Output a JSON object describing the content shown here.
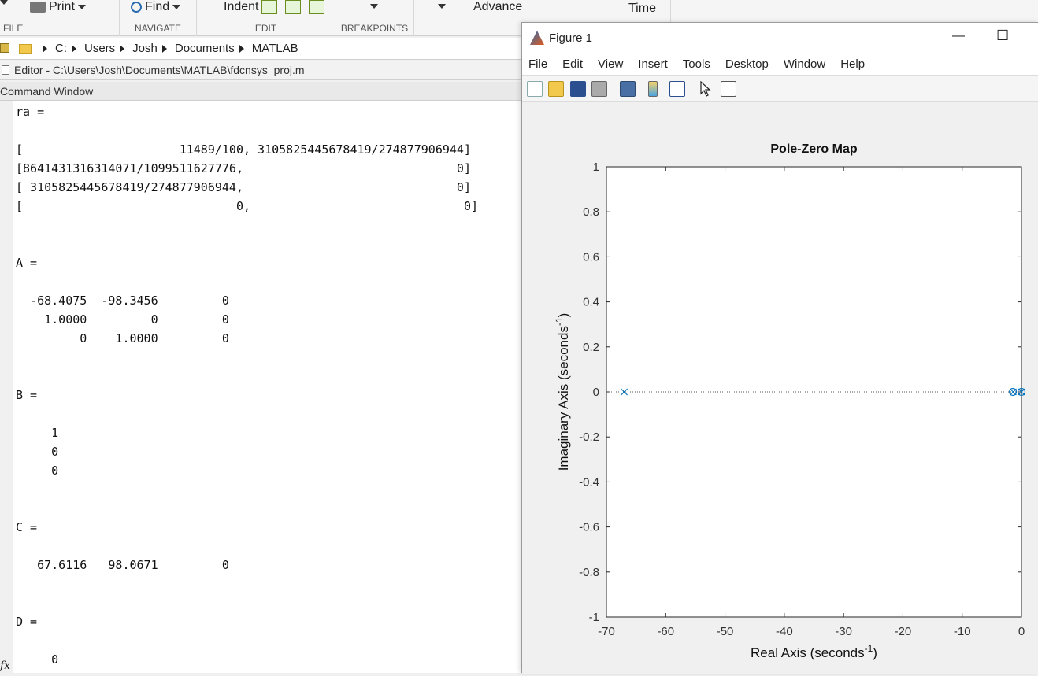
{
  "toolstrip": {
    "print_label": "Print",
    "find_label": "Find",
    "indent_label": "Indent",
    "advance_label": "Advance",
    "time_label": "Time",
    "groups": {
      "file": "FILE",
      "navigate": "NAVIGATE",
      "edit": "EDIT",
      "breakpoints": "BREAKPOINTS"
    }
  },
  "address": {
    "crumbs": [
      "C:",
      "Users",
      "Josh",
      "Documents",
      "MATLAB"
    ]
  },
  "editor_bar": {
    "title": "Editor - C:\\Users\\Josh\\Documents\\MATLAB\\fdcnsys_proj.m"
  },
  "command_window": {
    "title": "Command Window",
    "lines": [
      "ra =",
      "",
      "[                      11489/100, 3105825445678419/274877906944]",
      "[8641431316314071/1099511627776,                              0]",
      "[ 3105825445678419/274877906944,                              0]",
      "[                              0,                              0]",
      "",
      "",
      "A =",
      "",
      "  -68.4075  -98.3456         0",
      "    1.0000         0         0",
      "         0    1.0000         0",
      "",
      "",
      "B =",
      "",
      "     1",
      "     0",
      "     0",
      "",
      "",
      "C =",
      "",
      "   67.6116   98.0671         0",
      "",
      "",
      "D =",
      "",
      "     0"
    ],
    "prompt": "fx"
  },
  "figure": {
    "title": "Figure 1",
    "menu": [
      "File",
      "Edit",
      "View",
      "Insert",
      "Tools",
      "Desktop",
      "Window",
      "Help"
    ],
    "minimize_glyph": "—",
    "maximize_glyph": "☐"
  },
  "chart_data": {
    "type": "scatter",
    "title": "Pole-Zero Map",
    "xlabel": "Real Axis (seconds",
    "ylabel": "Imaginary Axis (seconds",
    "label_superscript": "-1",
    "label_close": ")",
    "xlim": [
      -70,
      0
    ],
    "ylim": [
      -1,
      1
    ],
    "xticks": [
      "-70",
      "-60",
      "-50",
      "-40",
      "-30",
      "-20",
      "-10",
      "0"
    ],
    "yticks": [
      "-1",
      "-0.8",
      "-0.6",
      "-0.4",
      "-0.2",
      "0",
      "0.2",
      "0.4",
      "0.6",
      "0.8",
      "1"
    ],
    "xtick_values": [
      -70,
      -60,
      -50,
      -40,
      -30,
      -20,
      -10,
      0
    ],
    "ytick_values": [
      -1,
      -0.8,
      -0.6,
      -0.4,
      -0.2,
      0,
      0.2,
      0.4,
      0.6,
      0.8,
      1
    ],
    "poles": [
      [
        -67.0,
        0
      ],
      [
        -1.4,
        0
      ],
      [
        0,
        0
      ]
    ],
    "zeros": [
      [
        -1.45,
        0
      ],
      [
        0,
        0
      ]
    ],
    "marker_color": "#0072bd",
    "zero_line": "dotted"
  }
}
